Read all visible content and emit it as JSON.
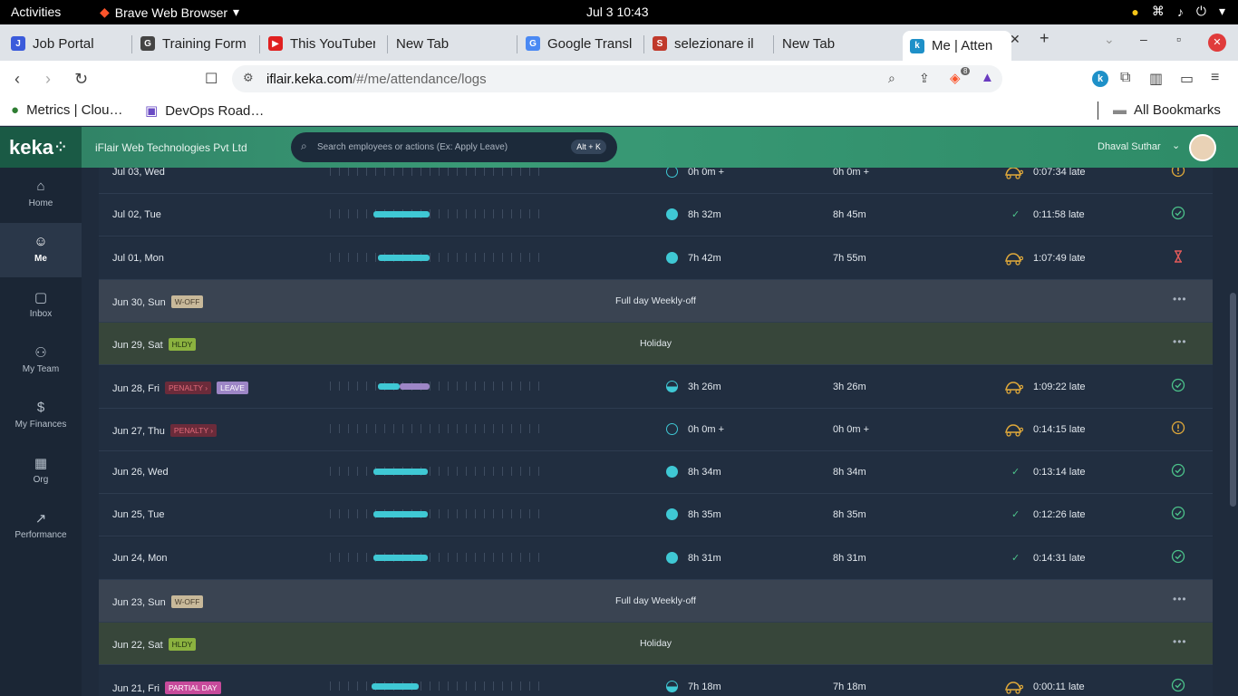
{
  "gnome": {
    "activities": "Activities",
    "app": "Brave Web Browser",
    "clock": "Jul 3  10:43"
  },
  "tabs": [
    {
      "label": "Job Portal",
      "color": "#3b5bdb",
      "fav": "J"
    },
    {
      "label": "Training Form",
      "color": "#444",
      "fav": "G"
    },
    {
      "label": "This YouTuber",
      "color": "#e02020",
      "fav": "▶"
    },
    {
      "label": "New Tab",
      "color": "",
      "fav": ""
    },
    {
      "label": "Google Transl",
      "color": "#4a89f3",
      "fav": "G"
    },
    {
      "label": "selezionare il",
      "color": "#c0392b",
      "fav": "S"
    },
    {
      "label": "New Tab",
      "color": "",
      "fav": ""
    },
    {
      "label": "Me | Atten",
      "color": "#1e90c8",
      "fav": "k"
    }
  ],
  "address": {
    "host": "iflair.keka.com",
    "path": "/#/me/attendance/logs",
    "brave_count": "8"
  },
  "bookmarks": [
    {
      "label": "Metrics | Clou…"
    },
    {
      "label": "DevOps Road…"
    }
  ],
  "all_bookmarks": "All Bookmarks",
  "header": {
    "logo": "keka",
    "org": "iFlair Web Technologies Pvt Ltd",
    "search_placeholder": "Search employees or actions (Ex: Apply Leave)",
    "shortcut": "Alt + K",
    "user": "Dhaval Suthar"
  },
  "sidebar": [
    {
      "label": "Home",
      "icon": "home-icon"
    },
    {
      "label": "Me",
      "icon": "person-icon",
      "active": true
    },
    {
      "label": "Inbox",
      "icon": "inbox-icon"
    },
    {
      "label": "My Team",
      "icon": "team-icon"
    },
    {
      "label": "My Finances",
      "icon": "finance-icon"
    },
    {
      "label": "Org",
      "icon": "org-icon"
    },
    {
      "label": "Performance",
      "icon": "performance-icon"
    }
  ],
  "rows": [
    {
      "type": "work",
      "date": "Jul 03, Wed",
      "badges": [],
      "bar": [],
      "dot": "empty",
      "effective": "0h 0m +",
      "gross": "0h 0m +",
      "arrival": "late-icon",
      "late": "0:07:34 late",
      "status": "warning"
    },
    {
      "type": "work",
      "date": "Jul 02, Tue",
      "badges": [],
      "bar": [
        {
          "s": 0.2,
          "e": 0.46
        }
      ],
      "dot": "full",
      "effective": "8h 32m",
      "gross": "8h 45m",
      "arrival": "check",
      "late": "0:11:58 late",
      "status": "ok"
    },
    {
      "type": "work",
      "date": "Jul 01, Mon",
      "badges": [],
      "bar": [
        {
          "s": 0.22,
          "e": 0.46
        }
      ],
      "dot": "full",
      "effective": "7h 42m",
      "gross": "7h 55m",
      "arrival": "late-icon",
      "late": "1:07:49 late",
      "status": "pending"
    },
    {
      "type": "woff",
      "date": "Jun 30, Sun",
      "badges": [
        {
          "t": "W-OFF",
          "c": "woff"
        }
      ],
      "text": "Full day Weekly-off"
    },
    {
      "type": "hldy",
      "date": "Jun 29, Sat",
      "badges": [
        {
          "t": "HLDY",
          "c": "hldy"
        }
      ],
      "text": "Holiday"
    },
    {
      "type": "work",
      "date": "Jun 28, Fri",
      "badges": [
        {
          "t": "PENALTY ›",
          "c": "pen"
        },
        {
          "t": "LEAVE",
          "c": "leave"
        }
      ],
      "bar": [
        {
          "s": 0.22,
          "e": 0.32
        },
        {
          "s": 0.32,
          "e": 0.46,
          "lv": true
        }
      ],
      "dot": "half",
      "effective": "3h 26m",
      "gross": "3h 26m",
      "arrival": "late-icon",
      "late": "1:09:22 late",
      "status": "ok"
    },
    {
      "type": "work",
      "date": "Jun 27, Thu",
      "badges": [
        {
          "t": "PENALTY ›",
          "c": "pen"
        }
      ],
      "bar": [],
      "dot": "empty",
      "effective": "0h 0m +",
      "gross": "0h 0m +",
      "arrival": "late-icon",
      "late": "0:14:15 late",
      "status": "warning"
    },
    {
      "type": "work",
      "date": "Jun 26, Wed",
      "badges": [],
      "bar": [
        {
          "s": 0.2,
          "e": 0.45
        }
      ],
      "dot": "full",
      "effective": "8h 34m",
      "gross": "8h 34m",
      "arrival": "check",
      "late": "0:13:14 late",
      "status": "ok"
    },
    {
      "type": "work",
      "date": "Jun 25, Tue",
      "badges": [],
      "bar": [
        {
          "s": 0.2,
          "e": 0.45
        }
      ],
      "dot": "full",
      "effective": "8h 35m",
      "gross": "8h 35m",
      "arrival": "check",
      "late": "0:12:26 late",
      "status": "ok"
    },
    {
      "type": "work",
      "date": "Jun 24, Mon",
      "badges": [],
      "bar": [
        {
          "s": 0.2,
          "e": 0.45
        }
      ],
      "dot": "full",
      "effective": "8h 31m",
      "gross": "8h 31m",
      "arrival": "check",
      "late": "0:14:31 late",
      "status": "ok"
    },
    {
      "type": "woff",
      "date": "Jun 23, Sun",
      "badges": [
        {
          "t": "W-OFF",
          "c": "woff"
        }
      ],
      "text": "Full day Weekly-off"
    },
    {
      "type": "hldy",
      "date": "Jun 22, Sat",
      "badges": [
        {
          "t": "HLDY",
          "c": "hldy"
        }
      ],
      "text": "Holiday"
    },
    {
      "type": "work",
      "date": "Jun 21, Fri",
      "badges": [
        {
          "t": "PARTIAL DAY",
          "c": "part"
        }
      ],
      "bar": [
        {
          "s": 0.19,
          "e": 0.41
        }
      ],
      "dot": "half",
      "effective": "7h 18m",
      "gross": "7h 18m",
      "arrival": "late-icon",
      "late": "0:00:11 late",
      "status": "ok"
    }
  ]
}
